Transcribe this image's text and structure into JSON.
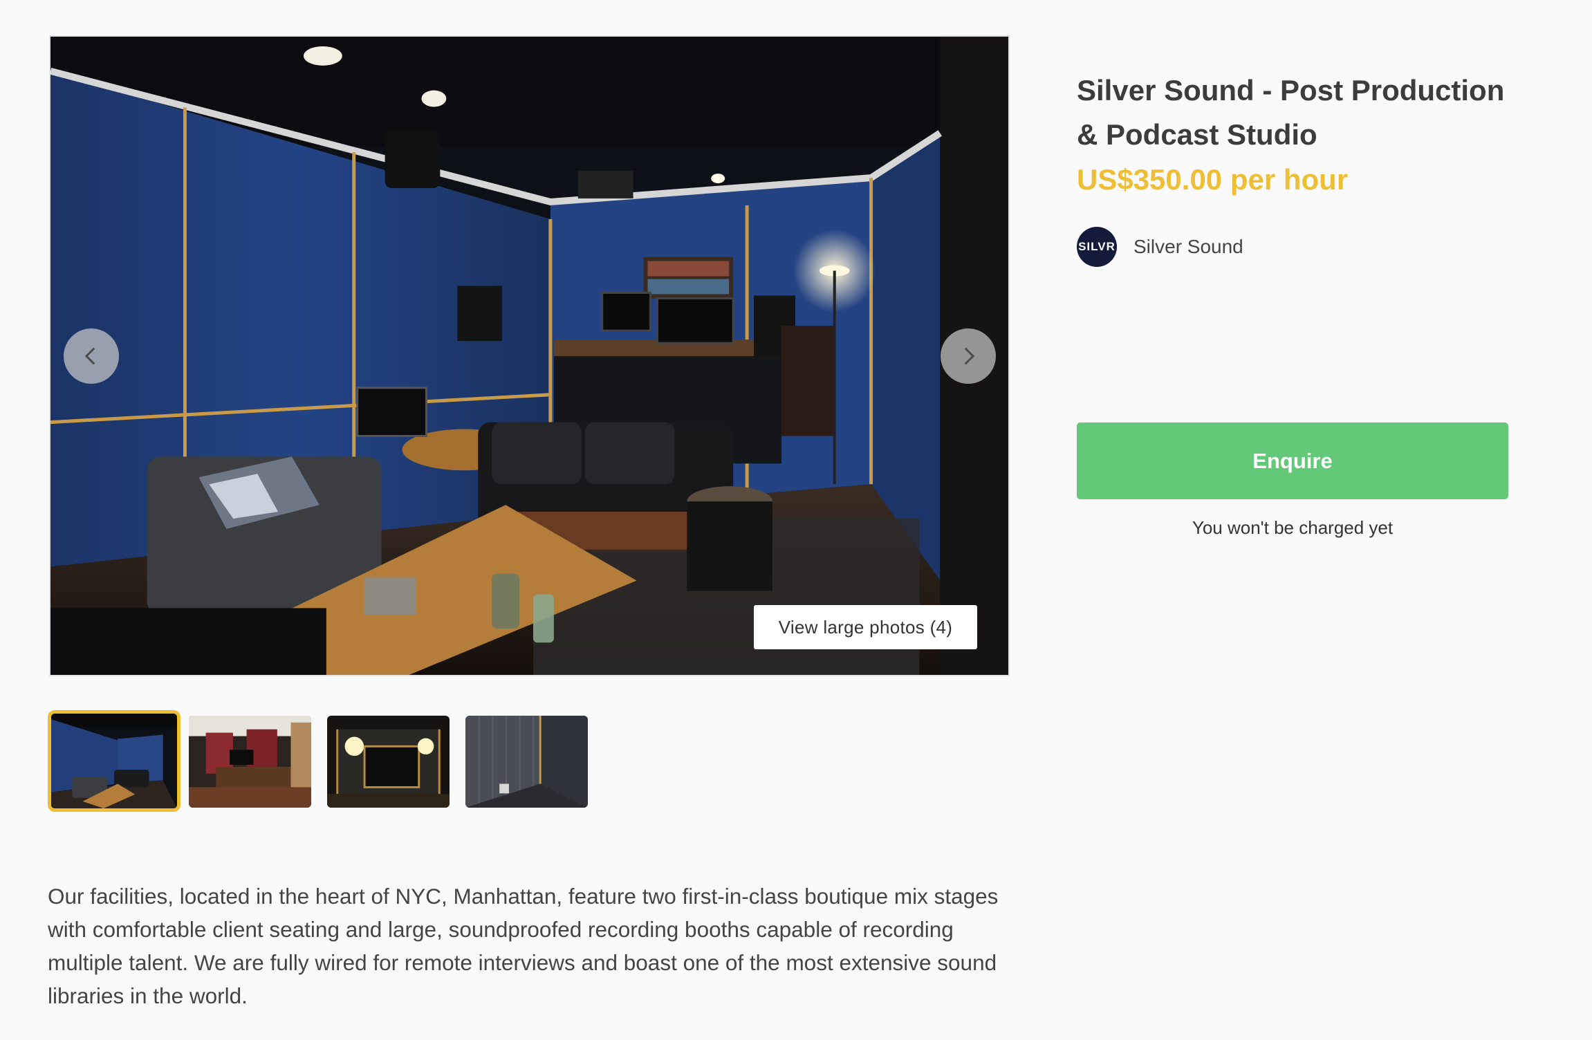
{
  "listing": {
    "title": "Silver Sound - Post Production & Podcast Studio",
    "price": "US$350.00 per hour",
    "host": {
      "logo_text": "SILVR",
      "name": "Silver Sound"
    },
    "enquire_label": "Enquire",
    "charge_note": "You won't be charged yet"
  },
  "gallery": {
    "view_large_label": "View large photos (4)",
    "photo_count": 4,
    "active_index": 0
  },
  "description": "Our facilities, located in the heart of NYC, Manhattan, feature two first-in-class boutique mix stages with comfortable client seating and large, soundproofed recording booths capable of recording multiple talent. We are fully wired for remote interviews and boast one of the most extensive sound libraries in the world.",
  "colors": {
    "accent": "#eebf35",
    "enquire": "#64c879",
    "nav_button": "#c8c8c8"
  },
  "icons": {
    "prev": "chevron-left-icon",
    "next": "chevron-right-icon"
  }
}
